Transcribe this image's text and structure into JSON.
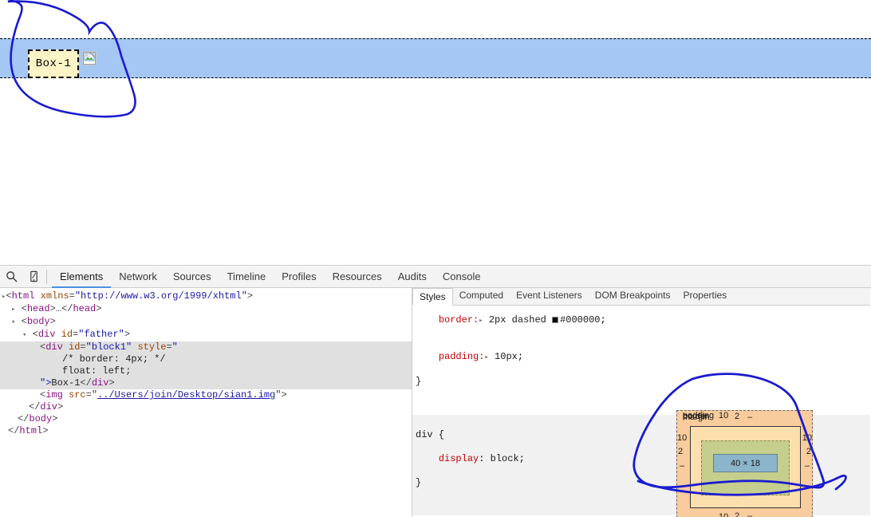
{
  "page": {
    "box_label": "Box-1",
    "broken_image_icon": "broken-image-icon",
    "highlight_color": "#a4c7f4",
    "box_fill_color": "#fcf3c6"
  },
  "devtools": {
    "toolbar_icons": [
      {
        "name": "inspect-element-icon",
        "glyph": "search"
      },
      {
        "name": "device-toolbar-icon",
        "glyph": "device"
      }
    ],
    "tabs": [
      {
        "label": "Elements",
        "active": true
      },
      {
        "label": "Network",
        "active": false
      },
      {
        "label": "Sources",
        "active": false
      },
      {
        "label": "Timeline",
        "active": false
      },
      {
        "label": "Profiles",
        "active": false
      },
      {
        "label": "Resources",
        "active": false
      },
      {
        "label": "Audits",
        "active": false
      },
      {
        "label": "Console",
        "active": false
      }
    ],
    "active_tab_underline_color": "#4a90e2",
    "dom": {
      "lines": [
        {
          "indent": 0,
          "arrow": "▸",
          "text": "<html xmlns=\"http://www.w3.org/1999/xhtml\">"
        },
        {
          "indent": 1,
          "arrow": "▸",
          "text": "<head>…</head>"
        },
        {
          "indent": 1,
          "arrow": "▾",
          "text": "<body>"
        },
        {
          "indent": 2,
          "arrow": "▾",
          "text": "<div id=\"father\">"
        },
        {
          "indent": 3,
          "arrow": "",
          "text": "<div id=\"block1\" style=\""
        },
        {
          "indent": 4,
          "arrow": "",
          "text": "/* border: 4px; */"
        },
        {
          "indent": 4,
          "arrow": "",
          "text": "float: left;"
        },
        {
          "indent": 3,
          "arrow": "",
          "text": "\">Box-1</div>"
        },
        {
          "indent": 3,
          "arrow": "",
          "text": "<img src=\"../Users/join/Desktop/sian1.img\">"
        },
        {
          "indent": 2,
          "arrow": "",
          "text": "</div>"
        },
        {
          "indent": 1,
          "arrow": "",
          "text": "</body>"
        },
        {
          "indent": 0,
          "arrow": "",
          "text": "</html>"
        }
      ],
      "tag_html": "html",
      "attr_xmlns_name": "xmlns",
      "attr_xmlns_value": "\"http://www.w3.org/1999/xhtml\"",
      "tag_head": "head",
      "tag_body": "body",
      "tag_div": "div",
      "attr_id_name": "id",
      "attr_id_father": "\"father\"",
      "attr_id_block1": "\"block1\"",
      "attr_style_name": "style",
      "style_open_quote": "\"",
      "style_comment": "/* border: 4px; */",
      "style_float": "float: left;",
      "style_close": "\">",
      "node_text": "Box-1",
      "tag_img": "img",
      "attr_src_name": "src",
      "attr_src_value": "../Users/join/Desktop/sian1.img",
      "selected_node": "div#block1"
    },
    "styles": {
      "tabs": [
        {
          "label": "Styles",
          "active": true
        },
        {
          "label": "Computed",
          "active": false
        },
        {
          "label": "Event Listeners",
          "active": false
        },
        {
          "label": "DOM Breakpoints",
          "active": false
        },
        {
          "label": "Properties",
          "active": false
        }
      ],
      "rules": [
        {
          "selector": "",
          "clipped": true,
          "declarations": [
            {
              "prop": "border",
              "value": "2px dashed",
              "color_swatch": "#000000",
              "color_text": "#000000"
            },
            {
              "prop": "padding",
              "value": "10px"
            }
          ]
        },
        {
          "selector": "div {",
          "close": "}",
          "declarations": [
            {
              "prop": "display",
              "value": "block"
            }
          ]
        }
      ],
      "line1_border_text": "border:",
      "line1_border_value": "2px dashed",
      "line1_border_color": "#000000",
      "line2_padding_text": "padding:",
      "line2_padding_value": "10px",
      "brace_close": "}",
      "rule2_selector": "div {",
      "rule2_prop": "display",
      "rule2_value": "block",
      "rule2_close": "}"
    },
    "box_model": {
      "margin_label": "margin",
      "margin_top": "–",
      "margin_right": "–",
      "margin_bottom": "–",
      "margin_left": "–",
      "border_label": "border",
      "border_top": "2",
      "border_right": "2",
      "border_bottom": "2",
      "border_left": "2",
      "padding_label": "padding",
      "padding_top": "10",
      "padding_right": "10",
      "padding_bottom": "10",
      "padding_left": "10",
      "content_size": "40 × 18",
      "colors": {
        "margin": "#f9cc9d",
        "border": "#fddfad",
        "padding": "#c5ce8c",
        "content": "#8cb4cb"
      }
    }
  },
  "annotations": {
    "ink_color": "#1a1ad0",
    "shapes": [
      {
        "name": "annotation-circle-box1",
        "target": "Box-1 element in page"
      },
      {
        "name": "annotation-circle-boxmodel",
        "target": "box model diagram"
      }
    ]
  }
}
